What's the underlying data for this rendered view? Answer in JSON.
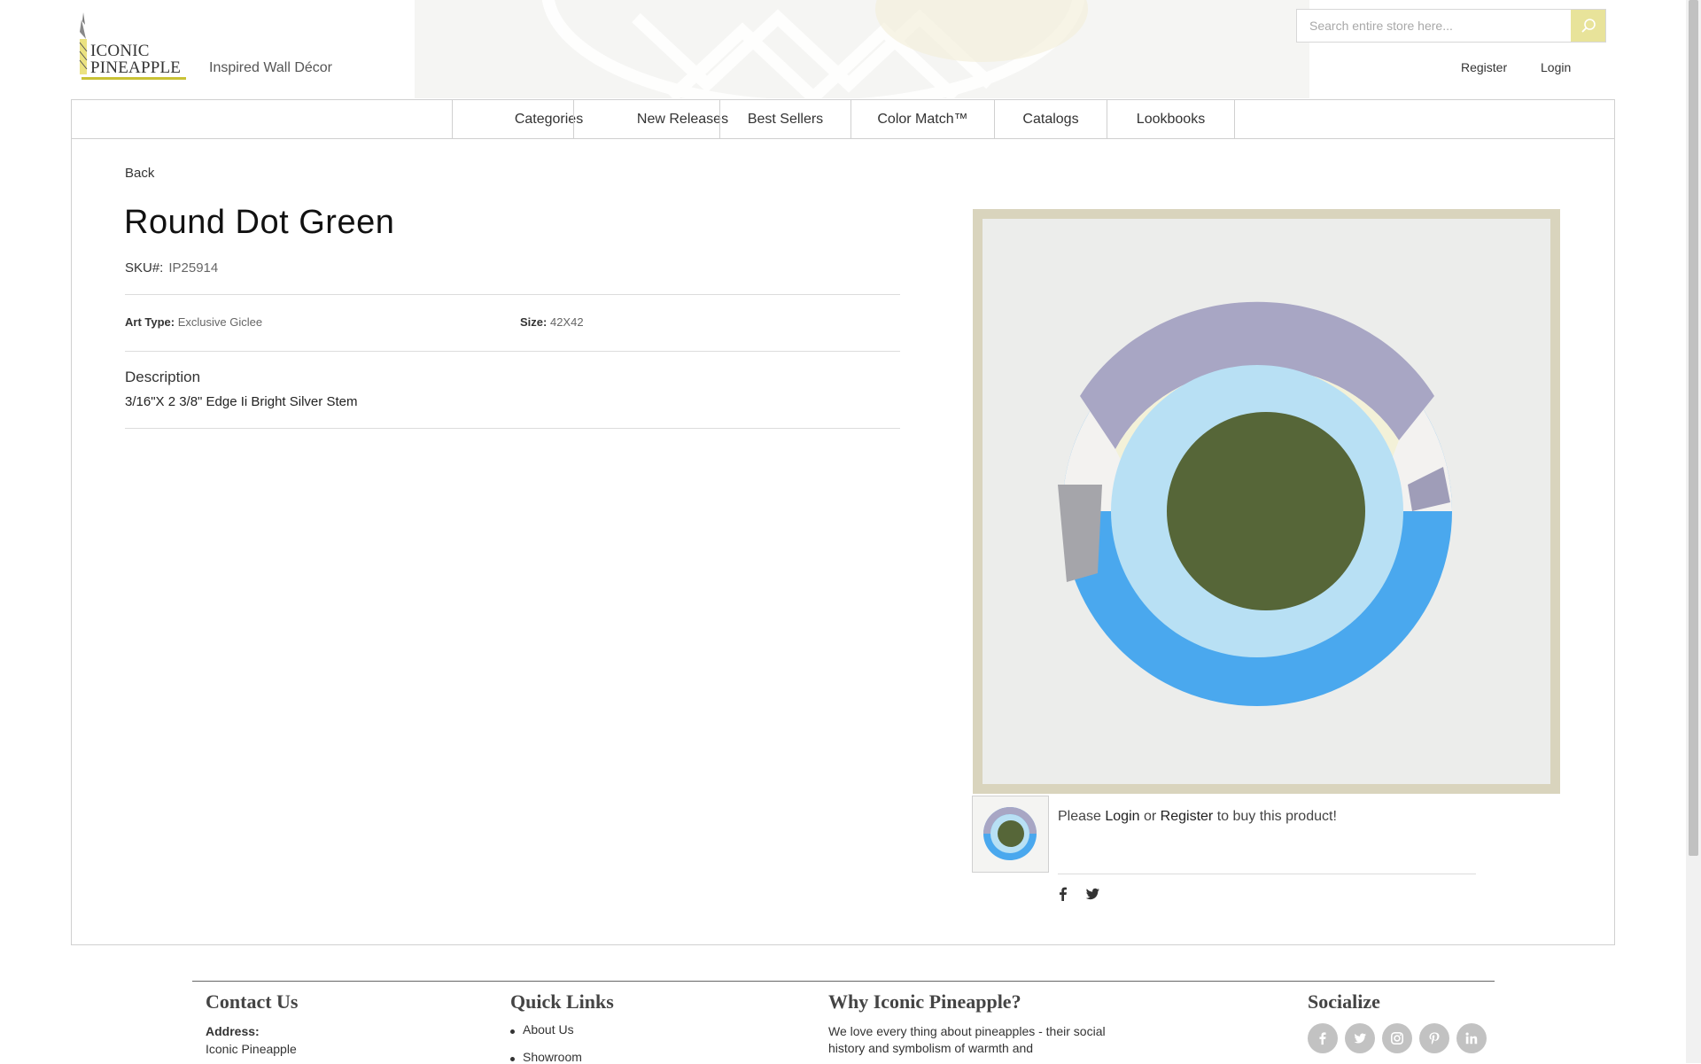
{
  "brand": {
    "logo_text_line1": "ICONIC",
    "logo_text_line2": "PINEAPPLE",
    "tagline": "Inspired Wall Décor",
    "accent_color": "#c9c235"
  },
  "header": {
    "search_placeholder": "Search entire store here...",
    "search_icon": "search-icon",
    "register_label": "Register",
    "login_label": "Login"
  },
  "nav": {
    "items": [
      {
        "label": "Categories"
      },
      {
        "label": "New Releases"
      },
      {
        "label": "Best Sellers"
      },
      {
        "label": "Color Match™"
      },
      {
        "label": "Catalogs"
      },
      {
        "label": "Lookbooks"
      }
    ]
  },
  "product": {
    "back_label": "Back",
    "title": "Round Dot Green",
    "sku_label": "SKU#:",
    "sku_value": "IP25914",
    "art_type_label": "Art Type:",
    "art_type_value": "Exclusive Giclee",
    "size_label": "Size:",
    "size_value": "42X42",
    "description_heading": "Description",
    "description_text": "3/16\"X 2 3/8\" Edge Ii Bright Silver Stem"
  },
  "purchase": {
    "prefix": "Please",
    "login_label": "Login",
    "or_text": "or",
    "register_label": "Register",
    "suffix": "to buy this product!"
  },
  "share": {
    "icons": [
      "facebook-icon",
      "twitter-icon"
    ]
  },
  "footer": {
    "contact": {
      "heading": "Contact Us",
      "address_label": "Address:",
      "address_line1": "Iconic Pineapple"
    },
    "quick_links": {
      "heading": "Quick Links",
      "items": [
        "About Us",
        "Showroom"
      ]
    },
    "why": {
      "heading": "Why Iconic Pineapple?",
      "text": "We love every thing about pineapples - their social history and symbolism of warmth and"
    },
    "socialize": {
      "heading": "Socialize",
      "icons": [
        "facebook-icon",
        "twitter-icon",
        "instagram-icon",
        "pinterest-icon",
        "linkedin-icon"
      ]
    }
  }
}
